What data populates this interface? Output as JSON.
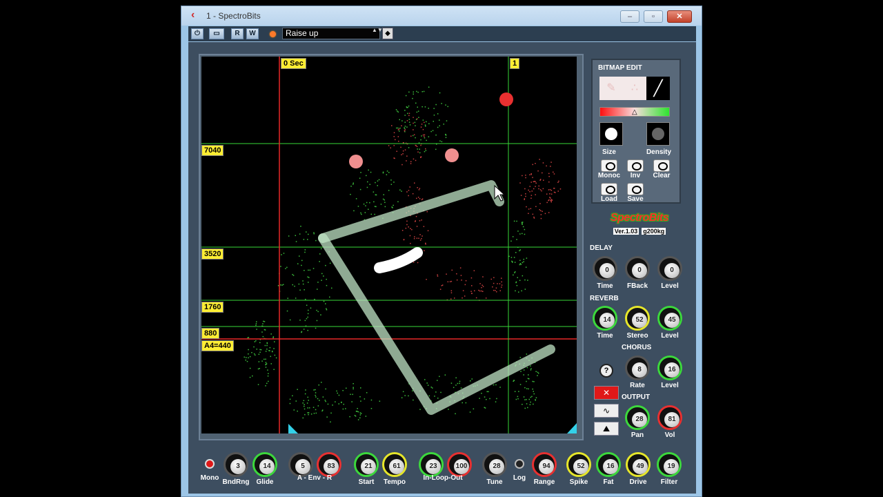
{
  "window": {
    "title": "1 - SpectroBits",
    "minimize": "–",
    "maximize": "▫",
    "close": "✕"
  },
  "toolbar": {
    "power": "⏻",
    "compare": "▭",
    "read": "R",
    "write": "W",
    "preset": "Raise up",
    "preset_arrows": "▲▼",
    "preset_menu": "◆"
  },
  "display": {
    "time_start": "0 Sec",
    "time_marker": "1",
    "freq_labels": [
      "7040",
      "3520",
      "1760",
      "880",
      "A4=440"
    ]
  },
  "bitmap_edit": {
    "title": "BITMAP EDIT",
    "tools": [
      "eraser",
      "spray",
      "pen"
    ],
    "size_label": "Size",
    "density_label": "Density",
    "buttons": [
      {
        "label": "Monoc"
      },
      {
        "label": "Inv"
      },
      {
        "label": "Clear"
      },
      {
        "label": "Load"
      },
      {
        "label": "Save"
      }
    ]
  },
  "logo": {
    "name": "SpectroBits",
    "version": "Ver.1.03",
    "author": "g200kg"
  },
  "delay": {
    "title": "DELAY",
    "knobs": [
      {
        "label": "Time",
        "value": "0"
      },
      {
        "label": "FBack",
        "value": "0"
      },
      {
        "label": "Level",
        "value": "0"
      }
    ]
  },
  "reverb": {
    "title": "REVERB",
    "knobs": [
      {
        "label": "Time",
        "value": "14"
      },
      {
        "label": "Stereo",
        "value": "52"
      },
      {
        "label": "Level",
        "value": "45"
      }
    ]
  },
  "chorus": {
    "title": "CHORUS",
    "knobs": [
      {
        "label": "Rate",
        "value": "8"
      },
      {
        "label": "Level",
        "value": "16"
      }
    ]
  },
  "output": {
    "title": "OUTPUT",
    "knobs": [
      {
        "label": "Pan",
        "value": "28"
      },
      {
        "label": "Vol",
        "value": "81"
      }
    ]
  },
  "side_tools": {
    "help": "?",
    "delete": "✕",
    "wave": "∿",
    "env": "⛰"
  },
  "bottom": {
    "mono_label": "Mono",
    "log_label": "Log",
    "knobs": [
      {
        "value": "3",
        "label": "BndRng"
      },
      {
        "value": "14",
        "label": "Glide"
      },
      {
        "value": "5",
        "label": ""
      },
      {
        "value": "83",
        "label": ""
      },
      {
        "value": "21",
        "label": "Start"
      },
      {
        "value": "61",
        "label": "Tempo"
      },
      {
        "value": "23",
        "label": ""
      },
      {
        "value": "100",
        "label": ""
      },
      {
        "value": "28",
        "label": "Tune"
      },
      {
        "value": "94",
        "label": "Range"
      },
      {
        "value": "52",
        "label": "Spike"
      },
      {
        "value": "16",
        "label": "Fat"
      },
      {
        "value": "49",
        "label": "Drive"
      },
      {
        "value": "19",
        "label": "Filter"
      }
    ],
    "group_labels": {
      "env": "A - Env - R",
      "loop": "In-Loop-Out"
    }
  },
  "colors": {
    "accent_yellow": "#ffee33",
    "grid_green": "#37d837",
    "marker_red": "#e82828",
    "knob_red": "#e83030",
    "knob_green": "#3cd83c",
    "knob_yellow": "#e6e62a"
  }
}
